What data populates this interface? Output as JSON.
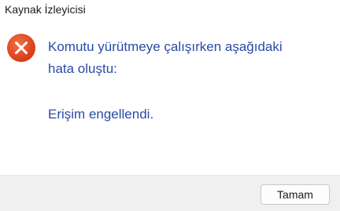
{
  "window": {
    "title": "Kaynak İzleyicisi"
  },
  "dialog": {
    "icon": "error-icon",
    "message_line1": "Komutu yürütmeye çalışırken aşağıdaki",
    "message_line2": "hata oluştu:",
    "detail": "Erişim engellendi.",
    "ok_label": "Tamam"
  },
  "colors": {
    "message_text": "#2a4aa8",
    "error_icon": "#e0461e",
    "footer_bg": "#f0f0f0"
  }
}
